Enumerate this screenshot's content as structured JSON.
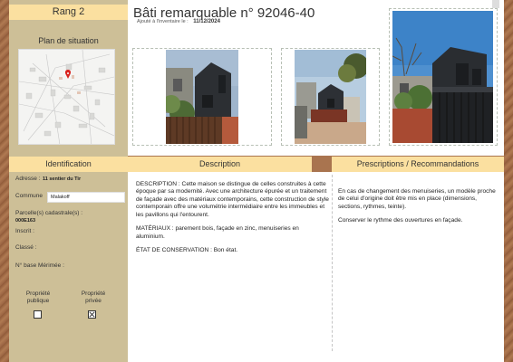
{
  "rang": "Rang 2",
  "title": {
    "prefix": "Bâti remarquable n°",
    "number": "92046-40"
  },
  "added": {
    "label": "Ajouté à l'inventaire le :",
    "date": "11/12/2024"
  },
  "plan": {
    "title": "Plan de situation"
  },
  "headers": {
    "identification": "Identification",
    "description": "Description",
    "prescriptions": "Prescriptions / Recommandations"
  },
  "identification": {
    "adresse_label": "Adresse :",
    "adresse_value": "11 sentier du Tir",
    "commune_label": "Commune",
    "commune_value": "Malakoff",
    "parcelles_label": "Parcelle(s) cadastrale(s) :",
    "parcelles_value": "000E163",
    "inscrit_label": "Inscrit :",
    "classe_label": "Classé :",
    "merimee_label": "N° base Mérimée :",
    "prop_publique": "Propriété publique",
    "prop_privee": "Propriété privée",
    "prop_publique_checked": false,
    "prop_privee_checked": true
  },
  "description": {
    "p1": "DESCRIPTION : Cette maison se distingue de celles construites à cette époque par sa modernité. Avec une architecture épurée et un traitement de façade avec des matériaux contemporains, cette construction de style contemporain offre une volumétrie intermédiaire entre les immeubles et les pavillons qui l'entourent.",
    "p2": "MATÉRIAUX : parement bois, façade en zinc, menuiseries en aluminium.",
    "p3": "ÉTAT DE CONSERVATION : Bon état."
  },
  "prescriptions": {
    "p1": "En cas de changement des menuiseries, un modèle proche de celui d'origine doit être mis en place (dimensions, sections, rythmes, teinte).",
    "p2": "Conserver le rythme des ouvertures en façade."
  },
  "colors": {
    "accent": "#fbe0a0",
    "sidebar": "#cdbf97",
    "wood": "#a9744f"
  }
}
